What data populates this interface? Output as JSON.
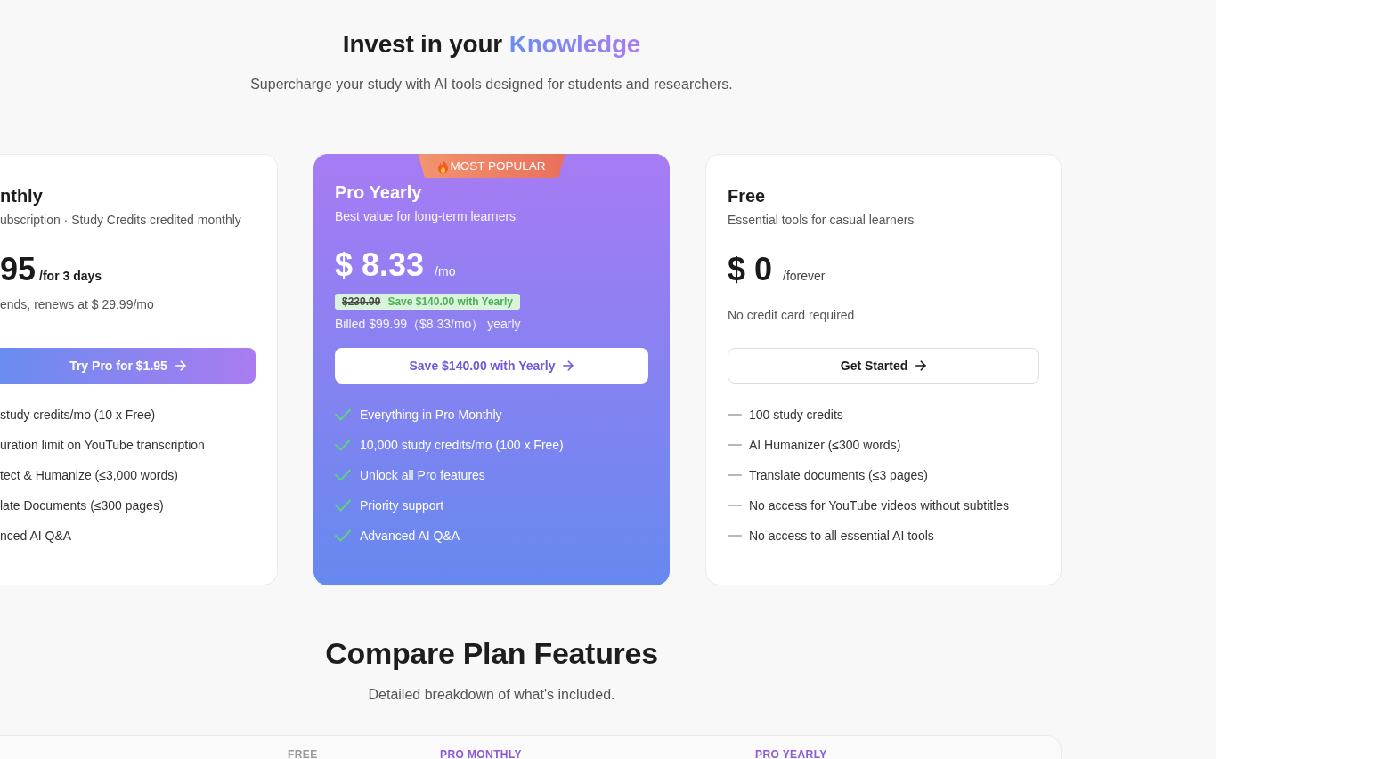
{
  "header": {
    "title": "Invest in your",
    "highlight": "Knowledge",
    "subtitle": "Supercharge your study with AI tools designed for students and researchers."
  },
  "plans": [
    {
      "kind": "trial",
      "name": "nthly",
      "description": "ubscription · Study Credits credited monthly",
      "price": "95",
      "period": "/for 3 days",
      "note": "ends, renews at $ 29.99/mo",
      "button": "Try Pro for $1.95",
      "features": [
        "study credits/mo (10 x Free)",
        "uration limit on YouTube transcription",
        "tect & Humanize (≤3,000 words)",
        "late Documents (≤300 pages)",
        "nced AI Q&A"
      ]
    },
    {
      "kind": "featured",
      "badge": "MOST POPULAR",
      "name": "Pro Yearly",
      "description": "Best value for long-term learners",
      "price": "$ 8.33",
      "period": "/mo",
      "discount": {
        "original": "$239.99",
        "saving": "Save $140.00 with Yearly"
      },
      "note": "Billed $99.99（$8.33/mo） yearly",
      "button": "Save $140.00 with Yearly",
      "features": [
        {
          "kind": "check",
          "text": "Everything in Pro Monthly"
        },
        {
          "kind": "check",
          "text": "10,000 study credits/mo (100 x Free)"
        },
        {
          "kind": "check",
          "text": "Unlock all Pro features"
        },
        {
          "kind": "check",
          "text": "Priority support"
        },
        {
          "kind": "check",
          "text": "Advanced AI Q&A"
        }
      ]
    },
    {
      "kind": "basic",
      "name": "Free",
      "description": "Essential tools for casual learners",
      "price": "$ 0",
      "period": "/forever",
      "note": "No credit card required",
      "button": "Get Started",
      "features": [
        {
          "kind": "dash",
          "text": "100 study credits"
        },
        {
          "kind": "dash",
          "text": "AI Humanizer (≤300 words)"
        },
        {
          "kind": "dash",
          "text": "Translate documents (≤3 pages)"
        },
        {
          "kind": "dash",
          "text": "No access for YouTube videos without subtitles"
        },
        {
          "kind": "dash",
          "text": "No access to all essential AI tools"
        }
      ]
    }
  ],
  "compare": {
    "title": "Compare Plan Features",
    "subtitle": "Detailed breakdown of what's included.",
    "columns": [
      {
        "label": "FREE",
        "color": "#9a9a9a"
      },
      {
        "label": "PRO MONTHLY",
        "color": "#8b5cd6"
      },
      {
        "label": "PRO YEARLY",
        "color": "#8b5cd6"
      }
    ]
  }
}
